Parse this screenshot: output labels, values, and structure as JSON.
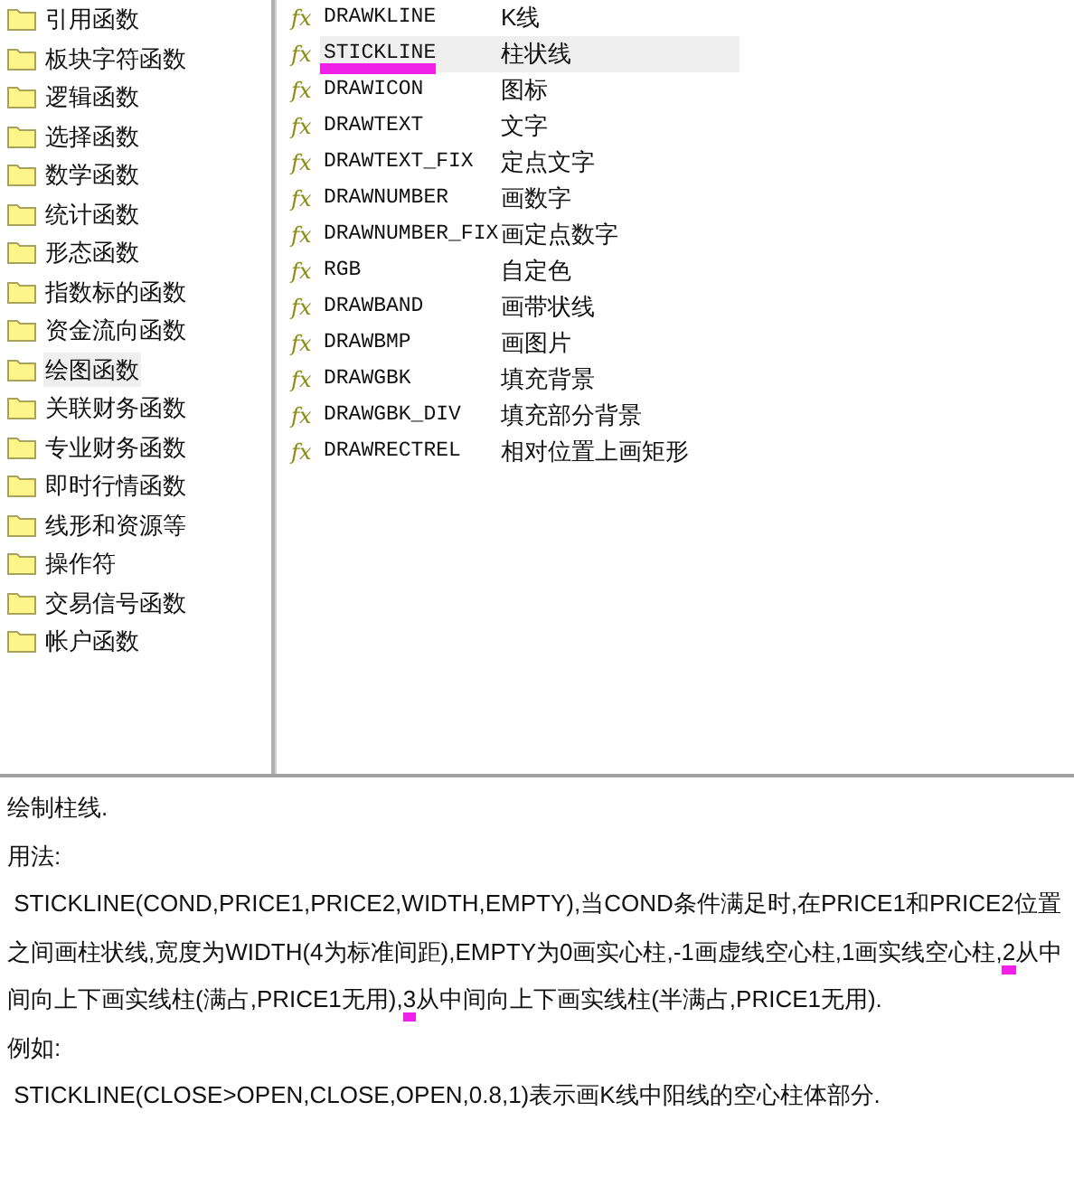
{
  "categories": [
    {
      "label": "引用函数",
      "selected": false
    },
    {
      "label": "板块字符函数",
      "selected": false
    },
    {
      "label": "逻辑函数",
      "selected": false
    },
    {
      "label": "选择函数",
      "selected": false
    },
    {
      "label": "数学函数",
      "selected": false
    },
    {
      "label": "统计函数",
      "selected": false
    },
    {
      "label": "形态函数",
      "selected": false
    },
    {
      "label": "指数标的函数",
      "selected": false
    },
    {
      "label": "资金流向函数",
      "selected": false
    },
    {
      "label": "绘图函数",
      "selected": true
    },
    {
      "label": "关联财务函数",
      "selected": false
    },
    {
      "label": "专业财务函数",
      "selected": false
    },
    {
      "label": "即时行情函数",
      "selected": false
    },
    {
      "label": "线形和资源等",
      "selected": false
    },
    {
      "label": "操作符",
      "selected": false
    },
    {
      "label": "交易信号函数",
      "selected": false
    },
    {
      "label": "帐户函数",
      "selected": false
    }
  ],
  "functions": [
    {
      "icon": "fx",
      "name": "DRAWKLINE",
      "description": "K线",
      "selected": false,
      "marked": false
    },
    {
      "icon": "fx",
      "name": "STICKLINE",
      "description": "柱状线",
      "selected": true,
      "marked": true
    },
    {
      "icon": "fx",
      "name": "DRAWICON",
      "description": "图标",
      "selected": false,
      "marked": false
    },
    {
      "icon": "fx",
      "name": "DRAWTEXT",
      "description": "文字",
      "selected": false,
      "marked": false
    },
    {
      "icon": "fx",
      "name": "DRAWTEXT_FIX",
      "description": "定点文字",
      "selected": false,
      "marked": false
    },
    {
      "icon": "fx",
      "name": "DRAWNUMBER",
      "description": "画数字",
      "selected": false,
      "marked": false
    },
    {
      "icon": "fx",
      "name": "DRAWNUMBER_FIX",
      "description": "画定点数字",
      "selected": false,
      "marked": false
    },
    {
      "icon": "fx",
      "name": "RGB",
      "description": "自定色",
      "selected": false,
      "marked": false
    },
    {
      "icon": "fx",
      "name": "DRAWBAND",
      "description": "画带状线",
      "selected": false,
      "marked": false
    },
    {
      "icon": "fx",
      "name": "DRAWBMP",
      "description": "画图片",
      "selected": false,
      "marked": false
    },
    {
      "icon": "fx",
      "name": "DRAWGBK",
      "description": "填充背景",
      "selected": false,
      "marked": false
    },
    {
      "icon": "fx",
      "name": "DRAWGBK_DIV",
      "description": "填充部分背景",
      "selected": false,
      "marked": false
    },
    {
      "icon": "fx",
      "name": "DRAWRECTREL",
      "description": "相对位置上画矩形",
      "selected": false,
      "marked": false
    }
  ],
  "help": {
    "summary": "绘制柱线.",
    "usage_label": "用法:",
    "usage": [
      {
        "text": " STICKLINE(COND,PRICE1,PRICE2,WIDTH,EMPTY),当COND条件满足时,在PRICE1和PRICE2位置之间画柱状线,宽度为WIDTH(4为标准间距),EMPTY为0画实心柱,-1画虚线空心柱,1画实线空心柱,",
        "marked": false
      },
      {
        "text": "2",
        "marked": true
      },
      {
        "text": "从中间向上下画实线柱(满占,PRICE1无用),",
        "marked": false
      },
      {
        "text": "3",
        "marked": true
      },
      {
        "text": "从中间向上下画实线柱(半满占,PRICE1无用).",
        "marked": false
      }
    ],
    "example_label": "例如:",
    "example": " STICKLINE(CLOSE>OPEN,CLOSE,OPEN,0.8,1)表示画K线中阳线的空心柱体部分."
  }
}
